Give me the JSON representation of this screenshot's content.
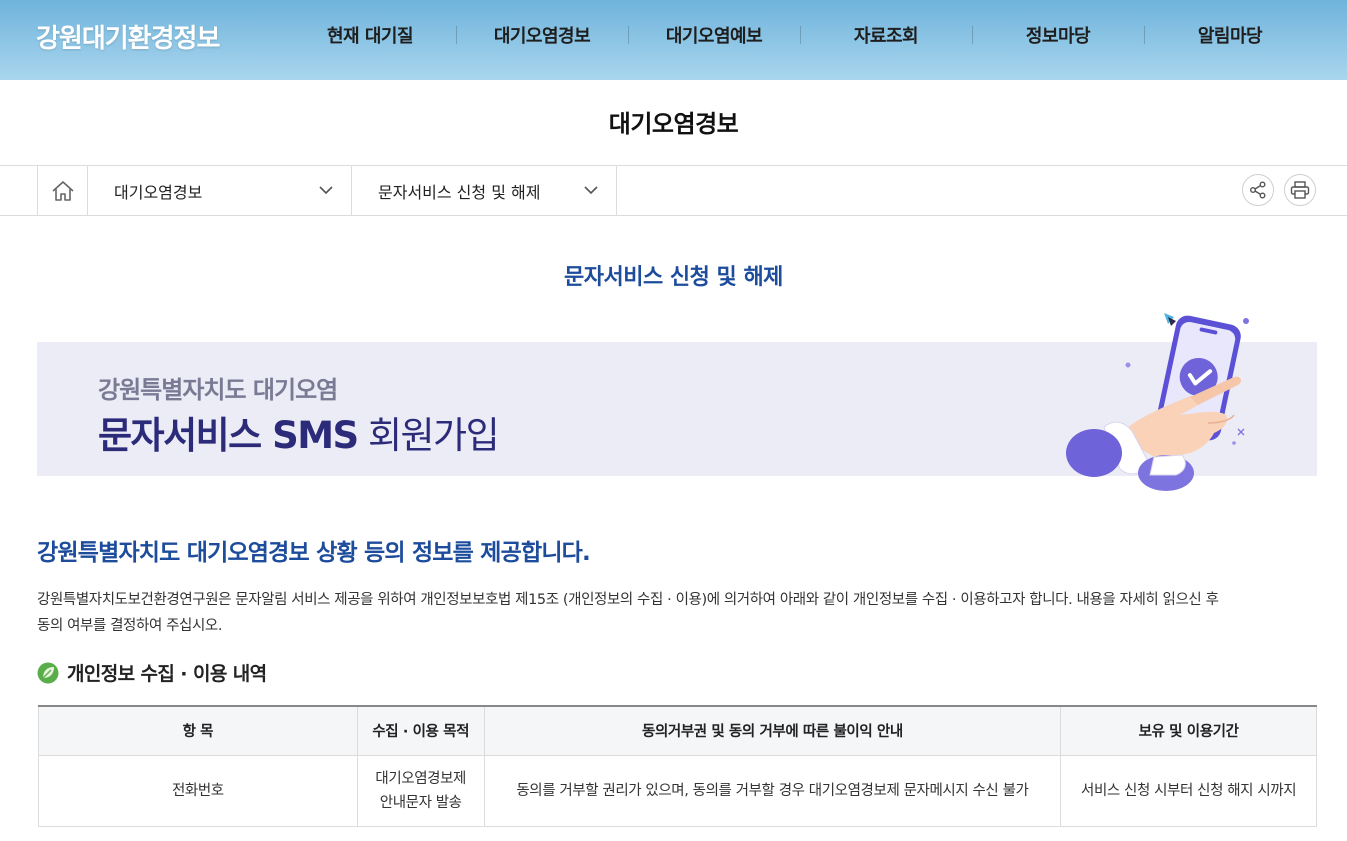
{
  "header": {
    "logo": "강원대기환경정보",
    "nav": [
      "현재 대기질",
      "대기오염경보",
      "대기오염예보",
      "자료조회",
      "정보마당",
      "알림마당"
    ]
  },
  "page_title": "대기오염경보",
  "breadcrumb": {
    "level1": "대기오염경보",
    "level2": "문자서비스 신청 및 해제"
  },
  "section_title": "문자서비스 신청 및 해제",
  "banner": {
    "subtitle": "강원특별자치도 대기오염",
    "title_strong": "문자서비스 SMS",
    "title_light": " 회원가입"
  },
  "intro": {
    "title": "강원특별자치도 대기오염경보 상황 등의 정보를 제공합니다.",
    "body_line1": "강원특별자치도보건환경연구원은 문자알림 서비스 제공을 위하여 개인정보보호법 제15조 (개인정보의 수집 · 이용)에 의거하여 아래와 같이 개인정보를 수집 · 이용하고자 합니다. 내용을 자세히 읽으신 후",
    "body_line2": "동의 여부를 결정하여 주십시오."
  },
  "privacy": {
    "heading": "개인정보 수집 · 이용 내역",
    "columns": [
      "항 목",
      "수집 · 이용 목적",
      "동의거부권 및 동의 거부에 따른 불이익 안내",
      "보유 및 이용기간"
    ],
    "row": {
      "item": "전화번호",
      "purpose_line1": "대기오염경보제",
      "purpose_line2": "안내문자 발송",
      "refusal": "동의를 거부할 권리가 있으며, 동의를 거부할 경우 대기오염경보제 문자메시지 수신 불가",
      "retention": "서비스 신청 시부터 신청 해지 시까지"
    }
  },
  "colors": {
    "header_gradient_top": "#6fb3db",
    "header_gradient_bottom": "#a9d6ee",
    "accent_blue": "#1d4c9c",
    "banner_bg": "#ececf6",
    "banner_text": "#2b2b7a",
    "illustration_purple": "#6e63d9"
  },
  "icons": [
    "home-icon",
    "chevron-down-icon",
    "share-icon",
    "print-icon",
    "leaf-icon",
    "check-icon"
  ]
}
